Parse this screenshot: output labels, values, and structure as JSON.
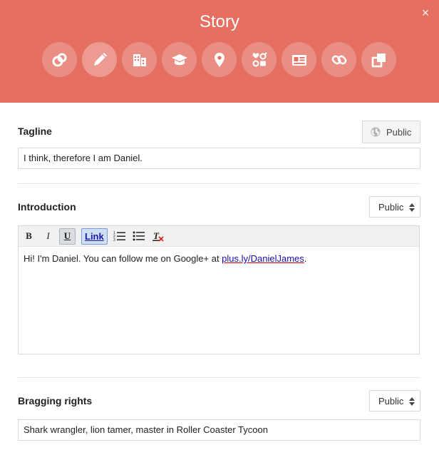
{
  "header": {
    "title": "Story",
    "close_label": "×",
    "icons": [
      "people-icon",
      "pencil-icon",
      "building-icon",
      "education-icon",
      "location-icon",
      "basic-info-icon",
      "contact-card-icon",
      "links-icon",
      "other-profiles-icon"
    ],
    "bg_color": "#e56f61"
  },
  "tagline": {
    "label": "Tagline",
    "visibility": "Public",
    "value": "I think, therefore I am Daniel."
  },
  "introduction": {
    "label": "Introduction",
    "visibility": "Public",
    "toolbar": {
      "bold": "B",
      "italic": "I",
      "underline": "U",
      "link": "Link"
    },
    "text_before": "Hi! I'm Daniel. You can follow me on Google+ at ",
    "link_text": "plus.ly/DanielJames",
    "text_after": "."
  },
  "bragging_rights": {
    "label": "Bragging rights",
    "visibility": "Public",
    "value": "Shark wrangler, lion tamer, master in Roller Coaster Tycoon"
  }
}
